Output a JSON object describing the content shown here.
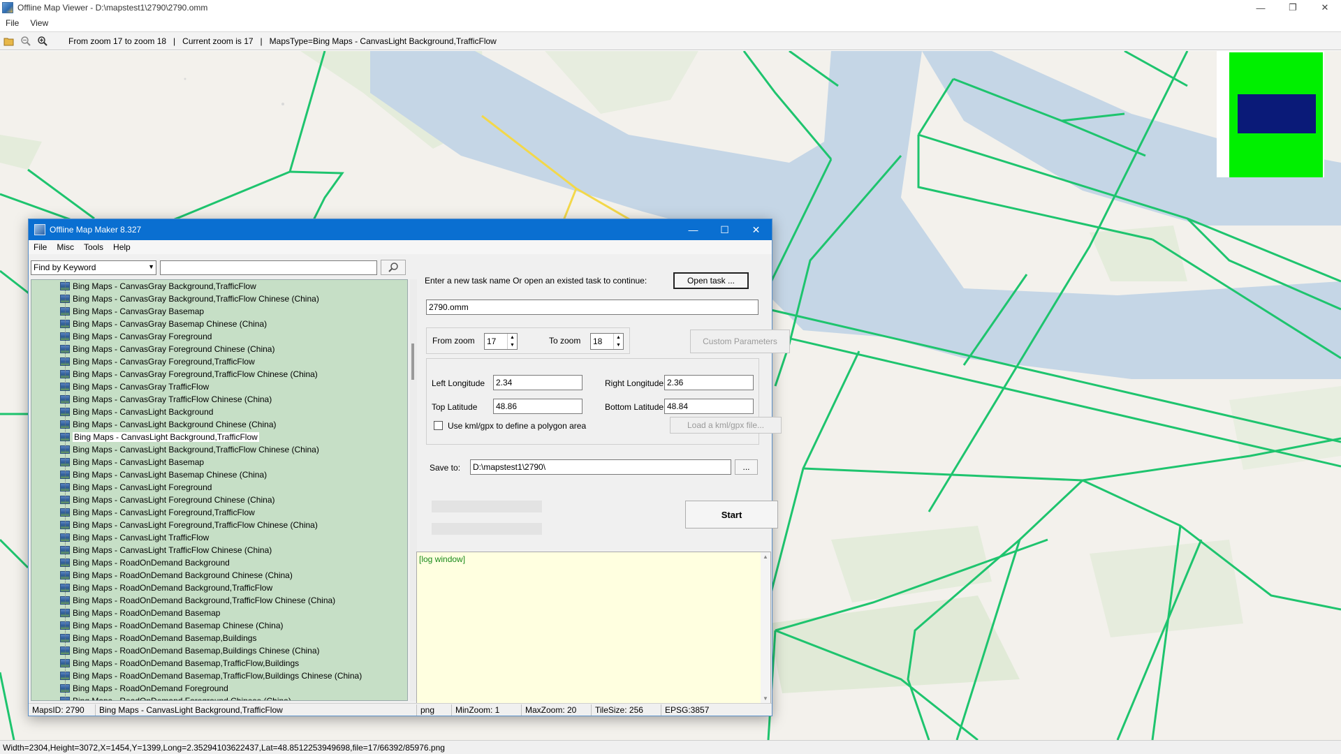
{
  "viewer": {
    "title": "Offline Map Viewer - D:\\mapstest1\\2790\\2790.omm",
    "menu": [
      "File",
      "View"
    ],
    "toolbar_info": "From zoom 17 to zoom 18   |   Current zoom is 17   |   MapsType=Bing Maps - CanvasLight Background,TrafficFlow",
    "status": "Width=2304,Height=3072,X=1454,Y=1399,Long=2.35294103622437,Lat=48.8512253949698,file=17/66392/85976.png"
  },
  "dialog": {
    "title": "Offline Map Maker 8.327",
    "menu": [
      "File",
      "Misc",
      "Tools",
      "Help"
    ],
    "find_by": "Find by Keyword",
    "map_list": [
      "Bing Maps - CanvasGray Background,TrafficFlow",
      "Bing Maps - CanvasGray Background,TrafficFlow Chinese (China)",
      "Bing Maps - CanvasGray Basemap",
      "Bing Maps - CanvasGray Basemap Chinese (China)",
      "Bing Maps - CanvasGray Foreground",
      "Bing Maps - CanvasGray Foreground Chinese (China)",
      "Bing Maps - CanvasGray Foreground,TrafficFlow",
      "Bing Maps - CanvasGray Foreground,TrafficFlow Chinese (China)",
      "Bing Maps - CanvasGray TrafficFlow",
      "Bing Maps - CanvasGray TrafficFlow Chinese (China)",
      "Bing Maps - CanvasLight Background",
      "Bing Maps - CanvasLight Background Chinese (China)",
      "Bing Maps - CanvasLight Background,TrafficFlow",
      "Bing Maps - CanvasLight Background,TrafficFlow Chinese (China)",
      "Bing Maps - CanvasLight Basemap",
      "Bing Maps - CanvasLight Basemap Chinese (China)",
      "Bing Maps - CanvasLight Foreground",
      "Bing Maps - CanvasLight Foreground Chinese (China)",
      "Bing Maps - CanvasLight Foreground,TrafficFlow",
      "Bing Maps - CanvasLight Foreground,TrafficFlow Chinese (China)",
      "Bing Maps - CanvasLight TrafficFlow",
      "Bing Maps - CanvasLight TrafficFlow Chinese (China)",
      "Bing Maps - RoadOnDemand Background",
      "Bing Maps - RoadOnDemand Background Chinese (China)",
      "Bing Maps - RoadOnDemand Background,TrafficFlow",
      "Bing Maps - RoadOnDemand Background,TrafficFlow Chinese (China)",
      "Bing Maps - RoadOnDemand Basemap",
      "Bing Maps - RoadOnDemand Basemap Chinese (China)",
      "Bing Maps - RoadOnDemand Basemap,Buildings",
      "Bing Maps - RoadOnDemand Basemap,Buildings Chinese (China)",
      "Bing Maps - RoadOnDemand Basemap,TrafficFlow,Buildings",
      "Bing Maps - RoadOnDemand Basemap,TrafficFlow,Buildings Chinese (China)",
      "Bing Maps - RoadOnDemand Foreground",
      "Bing Maps - RoadOnDemand Foreground Chinese (China)"
    ],
    "selected_index": 12,
    "task_prompt": "Enter a new task name Or open an existed task to continue:",
    "open_task_label": "Open task ...",
    "task_name": "2790.omm",
    "from_zoom_label": "From zoom",
    "from_zoom": "17",
    "to_zoom_label": "To zoom",
    "to_zoom": "18",
    "custom_params_label": "Custom Parameters",
    "left_lon_label": "Left Longitude",
    "left_lon": "2.34",
    "right_lon_label": "Right Longitude",
    "right_lon": "2.36",
    "top_lat_label": "Top Latitude",
    "top_lat": "48.86",
    "bottom_lat_label": "Bottom Latitude",
    "bottom_lat": "48.84",
    "kml_checkbox_label": "Use kml/gpx to define a polygon area",
    "load_kml_label": "Load a kml/gpx file...",
    "save_to_label": "Save to:",
    "save_to": "D:\\mapstest1\\2790\\",
    "browse_label": "...",
    "start_label": "Start",
    "log_text": "[log window]",
    "status": {
      "maps_id": "MapsID: 2790",
      "maps_name": "Bing Maps - CanvasLight Background,TrafficFlow",
      "format": "png",
      "min_zoom": "MinZoom: 1",
      "max_zoom": "MaxZoom: 20",
      "tile_size": "TileSize: 256",
      "epsg": "EPSG:3857"
    }
  },
  "colors": {
    "road": "#1ec46e",
    "river": "#c5d6e6",
    "park": "#e1ead7",
    "land": "#f3f1ec",
    "list_bg": "#c6dfc6",
    "title_blue": "#0a6fd1"
  }
}
